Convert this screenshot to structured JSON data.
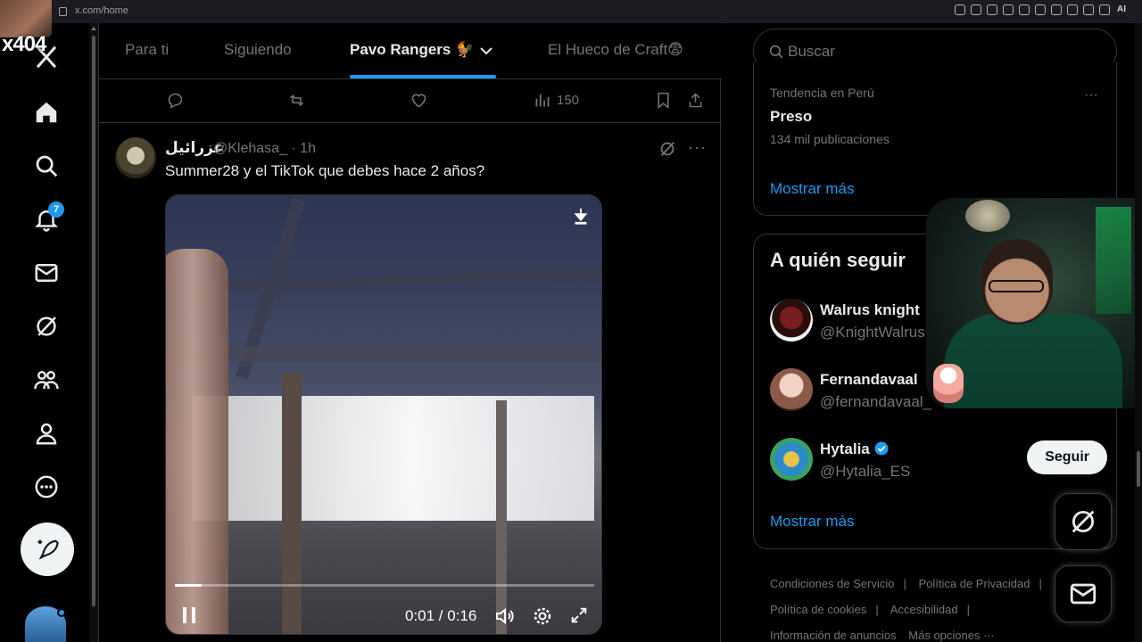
{
  "browser": {
    "url": "x.com/home",
    "ai_label": "AI"
  },
  "overlay": {
    "tag": "x404"
  },
  "nav": {
    "notifications_badge": "7"
  },
  "tabs": [
    {
      "label": "Para ti"
    },
    {
      "label": "Siguiendo"
    },
    {
      "label": "Pavo Rangers 🐓"
    },
    {
      "label": "El Hueco de Craft😨"
    }
  ],
  "action_row": {
    "views": "150"
  },
  "tweet": {
    "name": "عزرائيل",
    "handle": "@Klehasa_ · 1h",
    "more": "···",
    "text": "Summer28 y el TikTok que debes hace 2 años?",
    "video": {
      "time": "0:01 / 0:16",
      "progress": 0.063
    }
  },
  "search": {
    "placeholder": "Buscar"
  },
  "trend": {
    "meta": "Tendencia en Perú",
    "topic": "Preso",
    "count": "134 mil publicaciones",
    "more_dots": "···",
    "show_more": "Mostrar más"
  },
  "follow": {
    "title": "A quién seguir",
    "users": [
      {
        "name": "Walrus knight",
        "handle": "@KnightWalrus"
      },
      {
        "name": "Fernandavaal",
        "handle": "@fernandavaal_"
      },
      {
        "name": "Hytalia",
        "handle": "@Hytalia_ES",
        "button": "Seguir"
      }
    ],
    "show_more": "Mostrar más"
  },
  "footer": {
    "links": [
      "Condiciones de Servicio",
      "Política de Privacidad",
      "Política de cookies",
      "Accesibilidad",
      "Información de anuncios",
      "Más opciones ···"
    ],
    "separator": "|"
  },
  "colors": {
    "accent": "#1d9bf0",
    "background": "#000000",
    "text": "#e7e9ea",
    "muted": "#71767b"
  }
}
